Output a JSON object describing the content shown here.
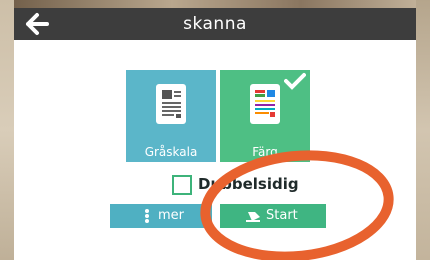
{
  "header": {
    "title": "skanna",
    "back_icon": "arrow-left-icon"
  },
  "modes": [
    {
      "label": "Gråskala",
      "icon": "document-grayscale-icon",
      "color": "#5bb6c9",
      "selected": false
    },
    {
      "label": "Färg",
      "icon": "document-color-icon",
      "color": "#4ebf84",
      "selected": true
    }
  ],
  "duplex": {
    "label": "Dubbelsidig",
    "checked": false
  },
  "actions": {
    "more_label": "mer",
    "more_icon": "vertical-dots-icon",
    "start_label": "Start",
    "start_icon": "scan-start-icon",
    "more_color": "#4fb0c2",
    "start_color": "#3fb582"
  },
  "annotation": {
    "shape": "ellipse",
    "color": "#e8622e"
  }
}
